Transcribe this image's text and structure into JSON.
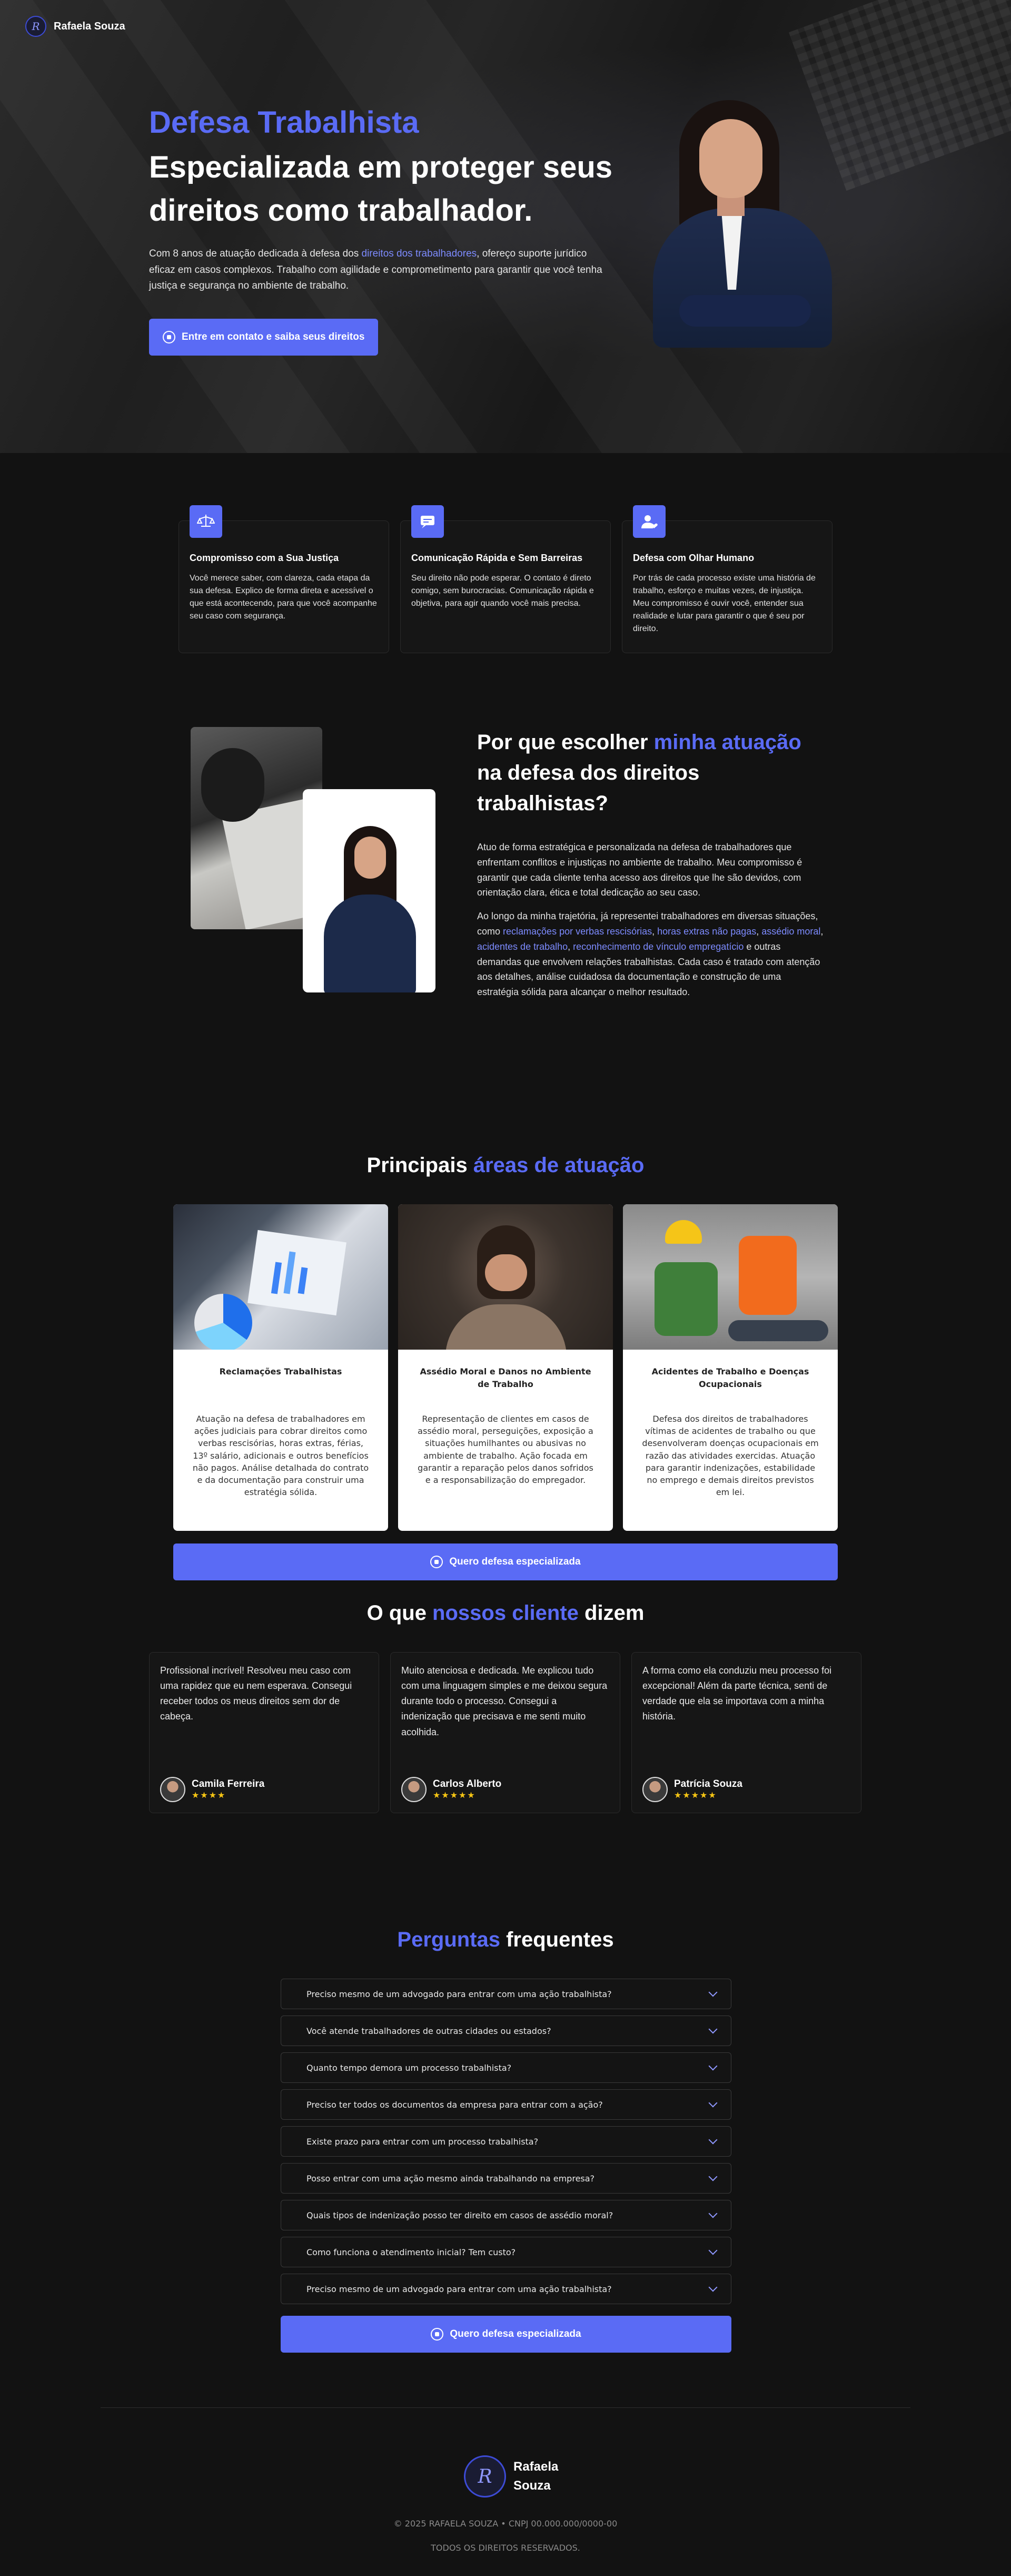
{
  "nav": {
    "brand": "Rafaela Souza",
    "logo_icon": "monogram-logo-icon",
    "logo_letter": "R"
  },
  "hero": {
    "title": "Defesa Trabalhista",
    "subtitle": "Especializada em proteger seus direitos como trabalhador.",
    "desc_before": "Com 8 anos de atuação dedicada à defesa dos ",
    "desc_highlight": "direitos dos trabalhadores",
    "desc_after": ", ofereço suporte jurídico eficaz em casos complexos. Trabalho com agilidade e comprometimento para garantir que você tenha justiça e segurança no ambiente de trabalho.",
    "cta": "Entre em contato e saiba seus direitos"
  },
  "features": [
    {
      "icon": "scales-icon",
      "title": "Compromisso com a Sua Justiça",
      "text": "Você merece saber, com clareza, cada etapa da sua defesa. Explico de forma direta e acessível o que está acontecendo, para que você acompanhe seu caso com segurança."
    },
    {
      "icon": "chat-icon",
      "title": "Comunicação Rápida e Sem Barreiras",
      "text": "Seu direito não pode esperar. O contato é direto comigo, sem burocracias. Comunicação rápida e objetiva, para agir quando você mais precisa."
    },
    {
      "icon": "user-heart-icon",
      "title": "Defesa com Olhar Humano",
      "text": "Por trás de cada processo existe uma história de trabalho, esforço e muitas vezes, de injustiça. Meu compromisso é ouvir você, entender sua realidade e lutar para garantir o que é seu por direito."
    }
  ],
  "why": {
    "title_a": "Por que escolher ",
    "title_hl": "minha atuação",
    "title_b": " na defesa dos direitos trabalhistas?",
    "p1": "Atuo de forma estratégica e personalizada na defesa de trabalhadores que enfrentam conflitos e injustiças no ambiente de trabalho. Meu compromisso é garantir que cada cliente tenha acesso aos direitos que lhe são devidos, com orientação clara, ética e total dedicação ao seu caso.",
    "p2_a": "Ao longo da minha trajetória, já representei trabalhadores em diversas situações, como ",
    "p2_hl1": "reclamações por verbas rescisórias",
    "p2_sep1": ", ",
    "p2_hl2": "horas extras não pagas",
    "p2_sep2": ", ",
    "p2_hl3": "assédio moral",
    "p2_sep3": ", ",
    "p2_hl4": "acidentes de trabalho",
    "p2_sep4": ", ",
    "p2_hl5": "reconhecimento de vínculo empregatício",
    "p2_b": " e outras demandas que envolvem relações trabalhistas. Cada caso é tratado com atenção aos detalhes, análise cuidadosa da documentação e construção de uma estratégia sólida para alcançar o melhor resultado."
  },
  "areas": {
    "title_a": "Principais ",
    "title_hl": "áreas de atuação",
    "cards": [
      {
        "title": "Reclamações Trabalhistas",
        "text": "Atuação na defesa de trabalhadores em ações judiciais para cobrar direitos como verbas rescisórias, horas extras, férias, 13º salário, adicionais e outros benefícios não pagos. Análise detalhada do contrato e da documentação para construir uma estratégia sólida."
      },
      {
        "title": "Assédio Moral e Danos no Ambiente de Trabalho",
        "text": "Representação de clientes em casos de assédio moral, perseguições, exposição a situações humilhantes ou abusivas no ambiente de trabalho. Ação focada em garantir a reparação pelos danos sofridos e a responsabilização do empregador."
      },
      {
        "title": "Acidentes de Trabalho e Doenças Ocupacionais",
        "text": "Defesa dos direitos de trabalhadores vítimas de acidentes de trabalho ou que desenvolveram doenças ocupacionais em razão das atividades exercidas. Atuação para garantir indenizações, estabilidade no emprego e demais direitos previstos em lei."
      }
    ],
    "cta": "Quero defesa especializada"
  },
  "testimonials": {
    "title_a": "O que ",
    "title_hl": "nossos cliente",
    "title_b": " dizem",
    "items": [
      {
        "text": "Profissional incrível! Resolveu meu caso com uma rapidez que eu nem esperava. Consegui receber todos os meus direitos sem dor de cabeça.",
        "name": "Camila Ferreira",
        "stars": "★★★★"
      },
      {
        "text": "Muito atenciosa e dedicada. Me explicou tudo com uma linguagem simples e me deixou segura durante todo o processo. Consegui a indenização que precisava e me senti muito acolhida.",
        "name": "Carlos Alberto",
        "stars": "★★★★★"
      },
      {
        "text": "A forma como ela conduziu meu processo foi excepcional! Além da parte técnica, senti de verdade que ela se importava com a minha história.",
        "name": "Patrícia Souza",
        "stars": "★★★★★"
      }
    ]
  },
  "faq": {
    "title_hl": "Perguntas",
    "title_b": " frequentes",
    "items": [
      "Preciso mesmo de um advogado para entrar com uma ação trabalhista?",
      "Você atende trabalhadores de outras cidades ou estados?",
      "Quanto tempo demora um processo trabalhista?",
      "Preciso ter todos os documentos da empresa para entrar com a ação?",
      "Existe prazo para entrar com um processo trabalhista?",
      "Posso entrar com uma ação mesmo ainda trabalhando na empresa?",
      "Quais tipos de indenização posso ter direito em casos de assédio moral?",
      "Como funciona o atendimento inicial? Tem custo?",
      "Preciso mesmo de um advogado para entrar com uma ação trabalhista?"
    ],
    "cta": "Quero defesa especializada"
  },
  "footer": {
    "name_line1": "Rafaela",
    "name_line2": "Souza",
    "copyright": "© 2025 RAFAELA SOUZA • CNPJ 00.000.000/0000-00",
    "rights": "TODOS OS DIREITOS RESERVADOS."
  },
  "colors": {
    "accent": "#5a6bf5",
    "background": "#121212",
    "card": "#161616",
    "stars": "#f6c514"
  }
}
